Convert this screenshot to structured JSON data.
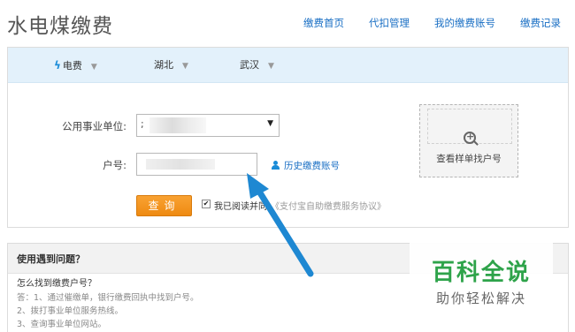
{
  "header": {
    "title": "水电煤缴费",
    "nav": [
      "缴费首页",
      "代扣管理",
      "我的缴费账号",
      "缴费记录"
    ]
  },
  "filters": {
    "type": "电费",
    "province": "湖北",
    "city": "武汉"
  },
  "form": {
    "unit_label": "公用事业单位:",
    "account_label": "户号:",
    "history_link": "历史缴费账号",
    "query_button": "查询",
    "agree_text": "我已阅读并同",
    "agree_link": "《支付宝自助缴费服务协议》",
    "agree_checked": true
  },
  "sample": {
    "label": "查看样单找户号"
  },
  "help": {
    "title": "使用遇到问题？",
    "question": "怎么找到缴费户号？",
    "answers": [
      "答：1、通过催缴单，银行缴费回执中找到户号。",
      "2、拨打事业单位服务热线。",
      "3、查询事业单位网站。"
    ]
  },
  "watermark": {
    "title": "百科全说",
    "subtitle": "助你轻松解决"
  },
  "colors": {
    "link": "#1a6fc4",
    "button": "#ee8a12",
    "filter_bar": "#e3f1fb",
    "arrow": "#1e88d2",
    "watermark": "#2ea34a"
  }
}
